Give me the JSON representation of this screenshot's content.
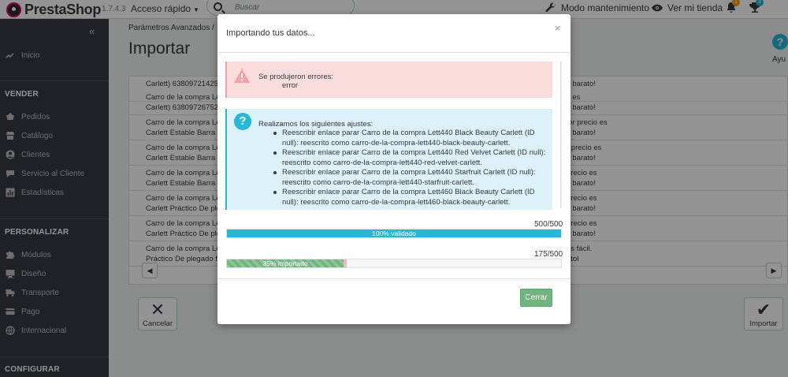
{
  "header": {
    "logo_text": "PrestaShop",
    "version": "1.7.4.3",
    "quick_access": "Acceso rápido",
    "search_placeholder": "Buscar",
    "maintenance": "Modo mantenimiento",
    "view_store": "Ver mi tienda",
    "notif_orders": "1",
    "notif_trophy": "3",
    "notif_colors": {
      "orders": "#f39c12",
      "trophy": "#25b9d7"
    }
  },
  "sidebar": {
    "collapse": "«",
    "home": "Inicio",
    "sections": [
      {
        "title": "VENDER",
        "items": [
          "Pedidos",
          "Catálogo",
          "Clientes",
          "Servicio al Cliente",
          "Estadísticas"
        ]
      },
      {
        "title": "PERSONALIZAR",
        "items": [
          "Módulos",
          "Diseño",
          "Transporte",
          "Pago",
          "Internacional"
        ]
      },
      {
        "title": "CONFIGURAR",
        "items": []
      }
    ]
  },
  "main": {
    "breadcrumb": "Parámetros Avanzados  /",
    "title": "Importar",
    "help": "Ayu",
    "rows": [
      {
        "left": [
          "Carlett) 63809721425",
          ""
        ],
        "right": [
          "s barato!",
          ""
        ]
      },
      {
        "left": [
          "Carro de la compra Le",
          "Carlett) 63809726752"
        ],
        "right": [
          "s es",
          "s barato!"
        ]
      },
      {
        "left": [
          "Carro de la compra Le",
          "Carlett Estable Barra a"
        ],
        "right": [
          "jor precio es",
          "s barato!"
        ]
      },
      {
        "left": [
          "Carro de la compra Le",
          "Carlett Estable Barra a"
        ],
        "right": [
          "r precio es",
          "s barato!"
        ]
      },
      {
        "left": [
          "Carro de la compra Le",
          "Carlett Estable Barra a"
        ],
        "right": [
          "precio es",
          "s barato!"
        ]
      },
      {
        "left": [
          "Carro de la compra Le",
          "Carlett Práctico De ple"
        ],
        "right": [
          "precio es",
          "s barato!"
        ]
      },
      {
        "left": [
          "Carro de la compra Le",
          "Carlett Práctico De ple"
        ],
        "right": [
          "precio es",
          "s barato!"
        ]
      },
      {
        "left": [
          "Carro de la compra Le",
          "Práctico De plegado fa"
        ],
        "right": [
          "es fácil.",
          "etol"
        ]
      }
    ],
    "cancel": "Cancelar",
    "import": "Importar"
  },
  "modal": {
    "title": "Importando tus datos...",
    "close": "×",
    "error_title": "Se produjeron errores:",
    "error_detail": "error",
    "info_title": "Realizamos los siguientes ajustes:",
    "adjustments": [
      "Reescribir enlace parar Carro de la compra Lett440 Black Beauty Carlett (ID null): reescrito como carro-de-la-compra-lett440-black-beauty-carlett.",
      "Reescribir enlace parar Carro de la compra Lett440 Red Velvet Carlett (ID null): reescrito como carro-de-la-compra-lett440-red-velvet-carlett.",
      "Reescribir enlace parar Carro de la compra Lett440 Starfruit Carlett (ID null): reescrito como carro-de-la-compra-lett440-starfruit-carlett.",
      "Reescribir enlace parar Carro de la compra Lett460 Black Beauty Carlett (ID null): reescrito como carro-de-la-compra-lett460-black-beauty-carlett."
    ],
    "validated_count": "500/500",
    "validated_label": "100% validado",
    "validated_fraction": 1.0,
    "imported_count": "175/500",
    "imported_label": "35% importado",
    "imported_fraction": 0.35,
    "button_close": "Cerrar",
    "colors": {
      "info": "#25b9d7",
      "success": "#70b580",
      "danger": "#fbdcdd"
    }
  }
}
